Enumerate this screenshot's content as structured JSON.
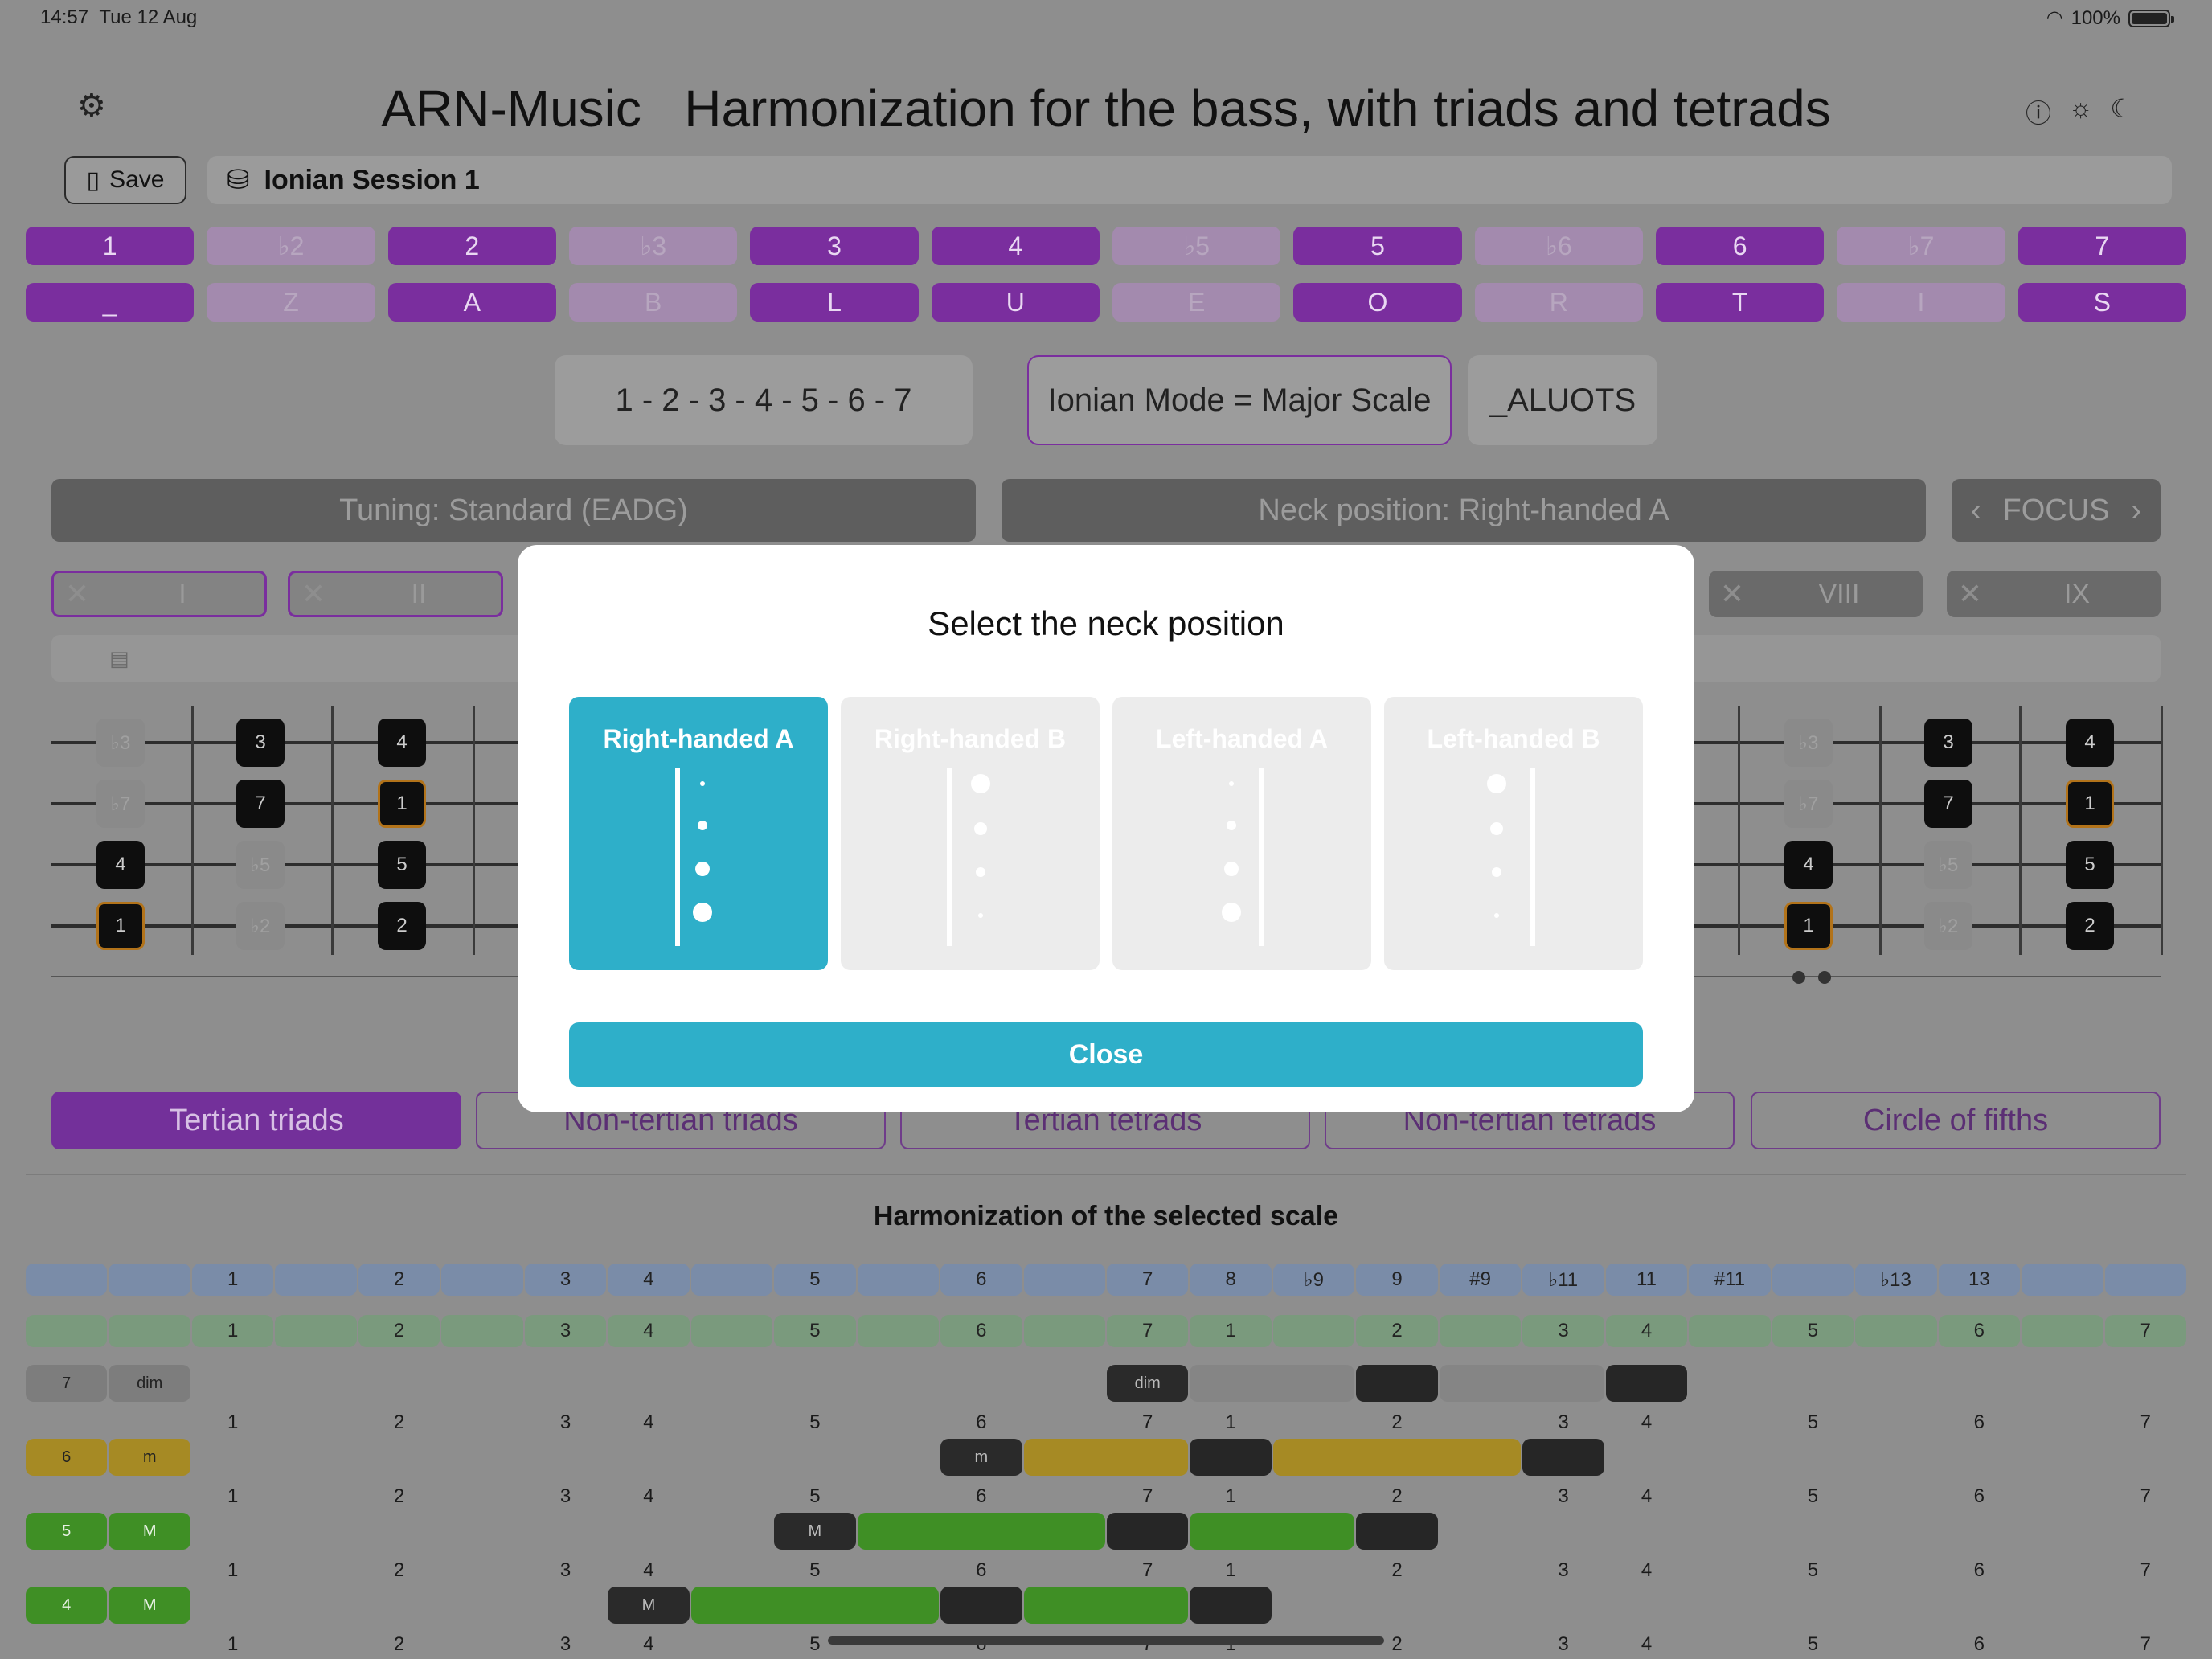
{
  "status": {
    "time": "14:57",
    "date": "Tue 12 Aug",
    "battery": "100%"
  },
  "header": {
    "app": "ARN-Music",
    "title": "Harmonization for the bass, with triads and tetrads"
  },
  "toolbar": {
    "save_label": "Save",
    "session_name": "Ionian Session 1"
  },
  "degrees": [
    {
      "label": "1",
      "on": true
    },
    {
      "label": "♭2",
      "on": false
    },
    {
      "label": "2",
      "on": true
    },
    {
      "label": "♭3",
      "on": false
    },
    {
      "label": "3",
      "on": true
    },
    {
      "label": "4",
      "on": true
    },
    {
      "label": "♭5",
      "on": false
    },
    {
      "label": "5",
      "on": true
    },
    {
      "label": "♭6",
      "on": false
    },
    {
      "label": "6",
      "on": true
    },
    {
      "label": "♭7",
      "on": false
    },
    {
      "label": "7",
      "on": true
    }
  ],
  "letters": [
    "_",
    "Z",
    "A",
    "B",
    "L",
    "U",
    "E",
    "O",
    "R",
    "T",
    "I",
    "S"
  ],
  "scale": {
    "formula": "1 - 2 - 3 - 4 - 5 - 6 - 7",
    "mode": "Ionian Mode = Major Scale",
    "code": "_ALUOTS"
  },
  "tuning_label": "Tuning: Standard (EADG)",
  "neck_label": "Neck position: Right-handed A",
  "focus_label": "FOCUS",
  "positions": [
    {
      "label": "I",
      "selected": true
    },
    {
      "label": "II",
      "selected": true
    },
    {
      "label": "VIII",
      "selected": false
    },
    {
      "label": "IX",
      "selected": false
    }
  ],
  "fretboard": {
    "left": [
      [
        "♭3",
        "3",
        "4"
      ],
      [
        "♭7",
        "7",
        "1"
      ],
      [
        "4",
        "♭5",
        "5"
      ],
      [
        "1",
        "♭2",
        "2"
      ]
    ],
    "right": [
      [
        "♭3",
        "3",
        "4"
      ],
      [
        "♭7",
        "7",
        "1"
      ],
      [
        "4",
        "♭5",
        "5"
      ],
      [
        "1",
        "♭2",
        "2"
      ]
    ]
  },
  "categories": [
    "Tertian triads",
    "Non-tertian triads",
    "Tertian tetrads",
    "Non-tertian tetrads",
    "Circle of fifths"
  ],
  "harmonization": {
    "title": "Harmonization of the selected scale",
    "interval_row": [
      "",
      "",
      "1",
      "",
      "2",
      "",
      "3",
      "4",
      "",
      "5",
      "",
      "6",
      "",
      "7",
      "8",
      "♭9",
      "9",
      "#9",
      "♭11",
      "11",
      "#11",
      "",
      "♭13",
      "13",
      "",
      ""
    ],
    "degree_row": [
      "",
      "",
      "1",
      "",
      "2",
      "",
      "3",
      "4",
      "",
      "5",
      "",
      "6",
      "",
      "7",
      "1",
      "",
      "2",
      "",
      "3",
      "4",
      "",
      "5",
      "",
      "6",
      "",
      "7"
    ],
    "chords": [
      {
        "degree": "7",
        "quality": "dim",
        "root_label": "dim"
      },
      {
        "degree": "6",
        "quality": "m",
        "root_label": "m"
      },
      {
        "degree": "5",
        "quality": "M",
        "root_label": "M"
      },
      {
        "degree": "4",
        "quality": "M",
        "root_label": "M"
      }
    ],
    "number_row": [
      "",
      "",
      "1",
      "",
      "2",
      "",
      "3",
      "4",
      "",
      "5",
      "",
      "6",
      "",
      "7",
      "1",
      "",
      "2",
      "",
      "3",
      "4",
      "",
      "5",
      "",
      "6",
      "",
      "7"
    ]
  },
  "modal": {
    "title": "Select the neck position",
    "options": [
      "Right-handed A",
      "Right-handed B",
      "Left-handed A",
      "Left-handed B"
    ],
    "selected": "Right-handed A",
    "close_label": "Close"
  },
  "colors": {
    "accent_purple": "#7a2e9e",
    "modal_teal": "#2eafc9",
    "chord_gold": "#a68a24",
    "chord_green": "#3f8f25"
  }
}
